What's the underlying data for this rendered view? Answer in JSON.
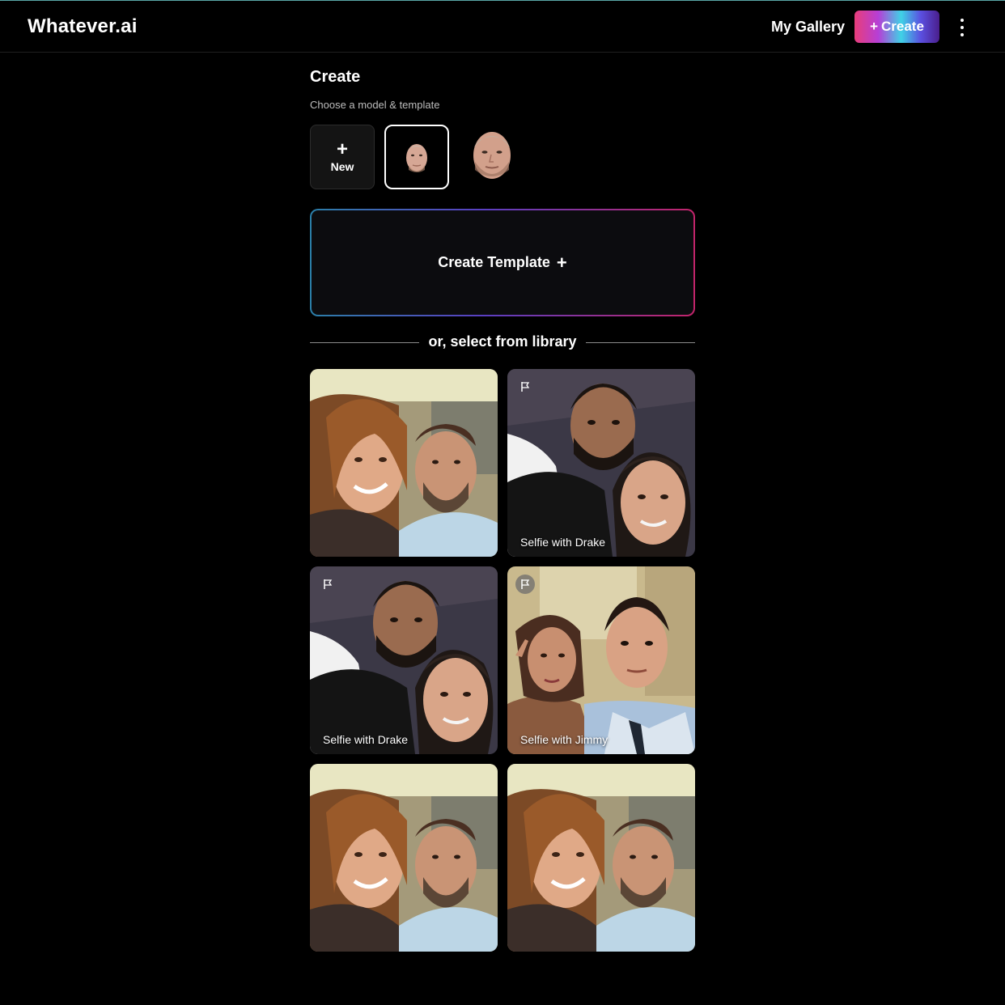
{
  "app": {
    "brand": "Whatever.ai",
    "nav": {
      "gallery": "My Gallery",
      "create": "Create",
      "create_plus": "+"
    }
  },
  "page": {
    "title": "Create",
    "subtitle": "Choose a model & template"
  },
  "models": {
    "new_label": "New",
    "new_plus": "+"
  },
  "template": {
    "create_label": "Create Template",
    "create_plus": "+"
  },
  "library": {
    "divider": "or, select from library",
    "items": [
      {
        "caption": ""
      },
      {
        "caption": "Selfie with Drake"
      },
      {
        "caption": "Selfie with Drake"
      },
      {
        "caption": "Selfie with Jimmy"
      },
      {
        "caption": ""
      },
      {
        "caption": ""
      }
    ]
  },
  "colors": {
    "background": "#000000",
    "template_border_start": "#2b7fa8",
    "template_border_end": "#c2246a"
  },
  "icons": [
    "plus-icon",
    "kebab-menu-icon",
    "flag-icon"
  ]
}
